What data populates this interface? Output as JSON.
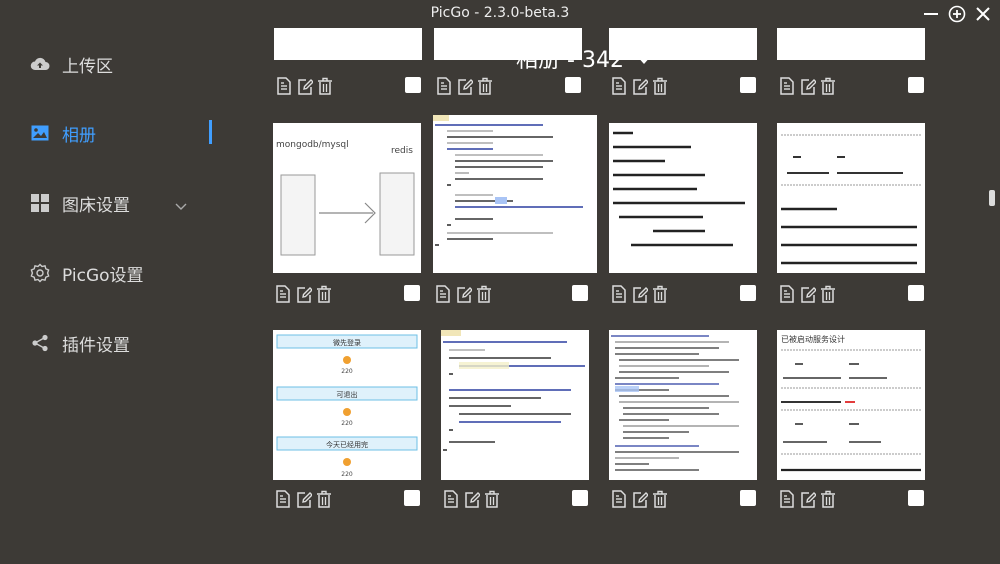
{
  "window": {
    "title": "PicGo - 2.3.0-beta.3"
  },
  "sidebar": {
    "items": [
      {
        "label": "上传区",
        "icon": "cloud-upload-icon"
      },
      {
        "label": "相册",
        "icon": "picture-icon",
        "active": true
      },
      {
        "label": "图床设置",
        "icon": "grid-icon"
      },
      {
        "label": "PicGo设置",
        "icon": "gear-icon"
      },
      {
        "label": "插件设置",
        "icon": "share-icon"
      }
    ]
  },
  "gallery": {
    "title": "相册 - 342"
  },
  "thumbnails": {
    "card_1": {
      "left_label": "mongodb/mysql",
      "right_label": "redis"
    },
    "card_9": {
      "buttons": [
        "微先登录",
        "可退出",
        "今天已经用完"
      ],
      "counts": [
        "220",
        "220",
        "220"
      ]
    },
    "card_12": {
      "heading": "已被启动服务设计"
    }
  },
  "colors": {
    "accent": "#409eff",
    "background": "#3d3a36"
  }
}
